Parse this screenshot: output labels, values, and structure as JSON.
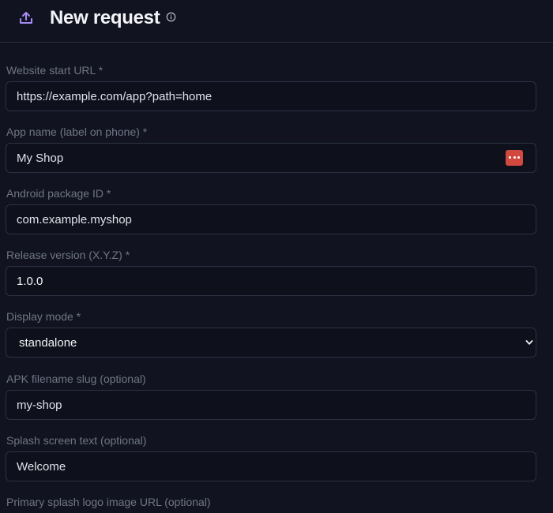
{
  "header": {
    "title": "New request",
    "icon": "upload-icon",
    "info_icon": "info-icon"
  },
  "form": {
    "fields": [
      {
        "label": "Website start URL *",
        "value": "https://example.com/app?path=home"
      },
      {
        "label": "App name (label on phone) *",
        "value": "My Shop",
        "badge_icon": "more-dots-icon"
      },
      {
        "label": "Android package ID *",
        "value": "com.example.myshop"
      },
      {
        "label": "Release version (X.Y.Z) *",
        "value": "1.0.0"
      },
      {
        "label": "Display mode *",
        "value": "standalone",
        "type": "select"
      },
      {
        "label": "APK filename slug (optional)",
        "value": "my-shop"
      },
      {
        "label": "Splash screen text (optional)",
        "value": "Welcome"
      },
      {
        "label": "Primary splash logo image URL (optional)"
      }
    ]
  },
  "colors": {
    "background": "#111420",
    "accent": "#a88bf5",
    "badge": "#d1483f",
    "field_border": "#2b3142",
    "label": "#6f7585"
  }
}
